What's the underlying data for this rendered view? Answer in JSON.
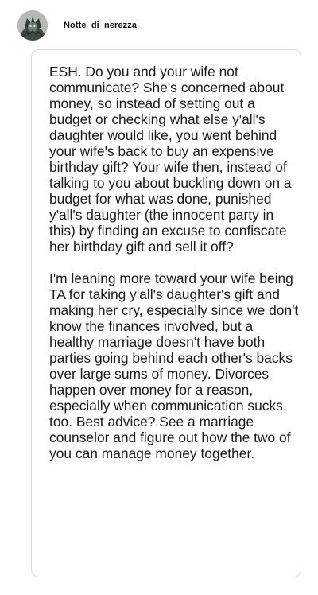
{
  "post": {
    "username": "Notte_di_nerezza",
    "avatar_icon": "user-avatar-icon",
    "paragraphs": [
      "ESH. Do you and your wife not communicate? She's concerned about money, so instead of setting out a budget or checking what else y'all's daughter would like, you went behind your wife's back to buy an expensive birthday gift? Your wife then, instead of talking to you about buckling down on a budget for what was done, punished y'all's daughter (the innocent party in this) by finding an excuse to confiscate her birthday gift and sell it off?",
      "I'm leaning more toward your wife being TA for taking y'all's daughter's gift and making her cry, especially since we don't know the finances involved, but a healthy marriage doesn't have both parties going behind each other's backs over large sums of money. Divorces happen over money for a reason, especially when communication sucks, too. Best advice? See a marriage counselor and figure out how the two of you can manage money together."
    ]
  },
  "colors": {
    "text": "#1a1a1a",
    "card_border": "#d9d9d9",
    "background": "#ffffff"
  }
}
